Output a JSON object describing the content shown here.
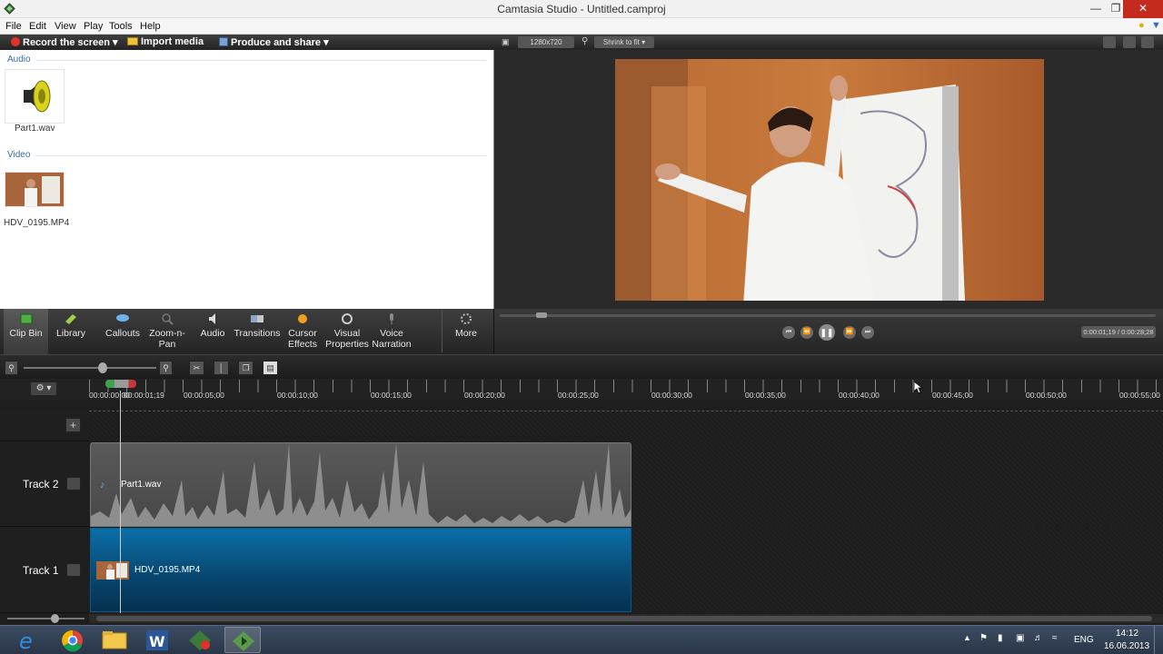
{
  "window": {
    "title": "Camtasia Studio - Untitled.camproj"
  },
  "menu": {
    "items": [
      "File",
      "Edit",
      "View",
      "Play",
      "Tools",
      "Help"
    ]
  },
  "left_toolbar": {
    "record_label": "Record the screen",
    "import_label": "Import media",
    "produce_label": "Produce and share"
  },
  "clip_bin": {
    "audio_section": "Audio",
    "video_section": "Video",
    "audio_file": "Part1.wav",
    "video_file": "HDV_0195.MP4"
  },
  "tasks": {
    "items": [
      {
        "label": "Clip Bin",
        "icon": "clip-bin-icon"
      },
      {
        "label": "Library",
        "icon": "library-icon"
      },
      {
        "label": "Callouts",
        "icon": "callouts-icon"
      },
      {
        "label": "Zoom-n-Pan",
        "icon": "zoom-n-pan-icon"
      },
      {
        "label": "Audio",
        "icon": "audio-icon"
      },
      {
        "label": "Transitions",
        "icon": "transitions-icon"
      },
      {
        "label": "Cursor Effects",
        "icon": "cursor-effects-icon"
      },
      {
        "label": "Visual Properties",
        "icon": "visual-properties-icon"
      },
      {
        "label": "Voice Narration",
        "icon": "voice-narration-icon"
      },
      {
        "label": "More",
        "icon": "more-icon"
      }
    ]
  },
  "preview": {
    "canvas_size": "1280x720",
    "zoom_mode": "Shrink to fit",
    "timecode": "0:00:01;19 / 0:00:28;28"
  },
  "timeline": {
    "ruler_labels": [
      "00:00:00;00",
      "00:00:01;19",
      "00:00:05;00",
      "00:00:10;00",
      "00:00:15;00",
      "00:00:20;00",
      "00:00:25;00",
      "00:00:30;00",
      "00:00:35;00",
      "00:00:40;00",
      "00:00:45;00",
      "00:00:50;00",
      "00:00:55;00"
    ],
    "tracks": [
      {
        "name": "Track 2",
        "clip": "Part1.wav"
      },
      {
        "name": "Track 1",
        "clip": "HDV_0195.MP4"
      }
    ]
  },
  "taskbar": {
    "language": "ENG",
    "time": "14:12",
    "date": "16.06.2013"
  },
  "colors": {
    "record": "#e2312a",
    "video_clip": "#07456d",
    "audio_clip": "#4f4f4f",
    "close_button": "#c42b1c"
  }
}
